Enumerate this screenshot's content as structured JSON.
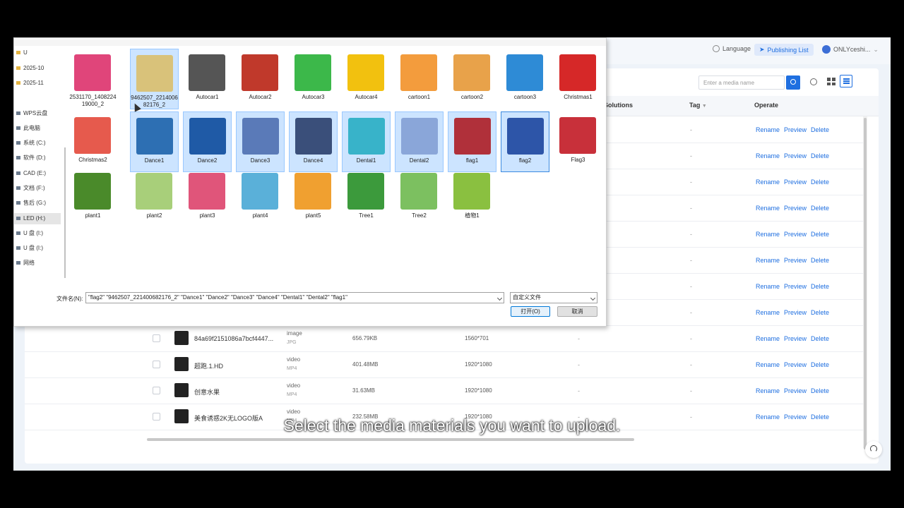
{
  "topbar": {
    "language_label": "Language",
    "publishing_label": "Publishing List",
    "user_label": "ONLYceshi..."
  },
  "toolbar": {
    "search_placeholder": "Enter a media name"
  },
  "table": {
    "columns": {
      "solutions": "ed Solutions",
      "tag": "Tag",
      "operate": "Operate"
    },
    "ops": {
      "rename": "Rename",
      "preview": "Preview",
      "delete": "Delete"
    },
    "dash": "-",
    "rows": [
      {
        "name": "84a69f2151086a7bcf4447...",
        "type": "image",
        "format": "JPG",
        "size": "656.79KB",
        "resolution": "1560*701"
      },
      {
        "name": "超跑.1.HD",
        "type": "video",
        "format": "MP4",
        "size": "401.48MB",
        "resolution": "1920*1080"
      },
      {
        "name": "创意水果",
        "type": "video",
        "format": "MP4",
        "size": "31.63MB",
        "resolution": "1920*1080"
      },
      {
        "name": "美食诱惑2K无LOGO版A",
        "type": "video",
        "format": "MP4",
        "size": "232.58MB",
        "resolution": "1920*1080"
      }
    ]
  },
  "dialog": {
    "nav": [
      {
        "label": "U",
        "kind": "folder"
      },
      {
        "label": "2025-10",
        "kind": "folder"
      },
      {
        "label": "2025-11",
        "kind": "folder"
      },
      {
        "label": "WPS云盘",
        "kind": "drive"
      },
      {
        "label": "此电脑",
        "kind": "drive"
      },
      {
        "label": "系统 (C:)",
        "kind": "drive"
      },
      {
        "label": "软件 (D:)",
        "kind": "drive"
      },
      {
        "label": "CAD (E:)",
        "kind": "drive"
      },
      {
        "label": "文档 (F:)",
        "kind": "drive"
      },
      {
        "label": "售后 (G:)",
        "kind": "drive"
      },
      {
        "label": "LED (H:)",
        "kind": "drive"
      },
      {
        "label": "U 盘 (I:)",
        "kind": "drive"
      },
      {
        "label": "U 盘 (I:)",
        "kind": "drive"
      },
      {
        "label": "网络",
        "kind": "drive"
      }
    ],
    "files": [
      {
        "label": "2531170_140822419000_2",
        "color": "#e0457a",
        "selected": false
      },
      {
        "label": "9462507_221400682176_2",
        "color": "#d9c27a",
        "selected": true
      },
      {
        "label": "Autocar1",
        "color": "#555555",
        "selected": false
      },
      {
        "label": "Autocar2",
        "color": "#c0392b",
        "selected": false
      },
      {
        "label": "Autocar3",
        "color": "#3cb84a",
        "selected": false
      },
      {
        "label": "Autocar4",
        "color": "#f2c10f",
        "selected": false
      },
      {
        "label": "cartoon1",
        "color": "#f39c3d",
        "selected": false
      },
      {
        "label": "cartoon2",
        "color": "#e8a24a",
        "selected": false
      },
      {
        "label": "cartoon3",
        "color": "#2e8bd6",
        "selected": false
      },
      {
        "label": "Christmas1",
        "color": "#d62828",
        "selected": false
      },
      {
        "label": "Christmas2",
        "color": "#e65a4d",
        "selected": false
      },
      {
        "label": "Dance1",
        "color": "#2d6fb3",
        "selected": true
      },
      {
        "label": "Dance2",
        "color": "#1f5aa6",
        "selected": true
      },
      {
        "label": "Dance3",
        "color": "#5a7ab8",
        "selected": true
      },
      {
        "label": "Dance4",
        "color": "#3a4f7a",
        "selected": true
      },
      {
        "label": "Dental1",
        "color": "#38b3c9",
        "selected": true
      },
      {
        "label": "Dental2",
        "color": "#8aa6d9",
        "selected": true
      },
      {
        "label": "flag1",
        "color": "#b0303a",
        "selected": true
      },
      {
        "label": "flag2",
        "color": "#2d55a8",
        "selected": true
      },
      {
        "label": "Flag3",
        "color": "#c8303a",
        "selected": false
      },
      {
        "label": "plant1",
        "color": "#4a8a2a",
        "selected": false
      },
      {
        "label": "plant2",
        "color": "#a8cf7a",
        "selected": false
      },
      {
        "label": "plant3",
        "color": "#e0557a",
        "selected": false
      },
      {
        "label": "plant4",
        "color": "#5ab0d9",
        "selected": false
      },
      {
        "label": "plant5",
        "color": "#f0a030",
        "selected": false
      },
      {
        "label": "Tree1",
        "color": "#3c9a3c",
        "selected": false
      },
      {
        "label": "Tree2",
        "color": "#7cc060",
        "selected": false
      },
      {
        "label": "植物1",
        "color": "#8ac040",
        "selected": false
      }
    ],
    "filename_label": "文件名(N):",
    "filename_value": "\"flag2\" \"9462507_221400682176_2\" \"Dance1\" \"Dance2\" \"Dance3\" \"Dance4\" \"Dental1\" \"Dental2\" \"flag1\"",
    "filetype_value": "自定义文件",
    "open_label": "打开(O)",
    "cancel_label": "取消"
  },
  "caption": "Select the media materials you want to upload."
}
